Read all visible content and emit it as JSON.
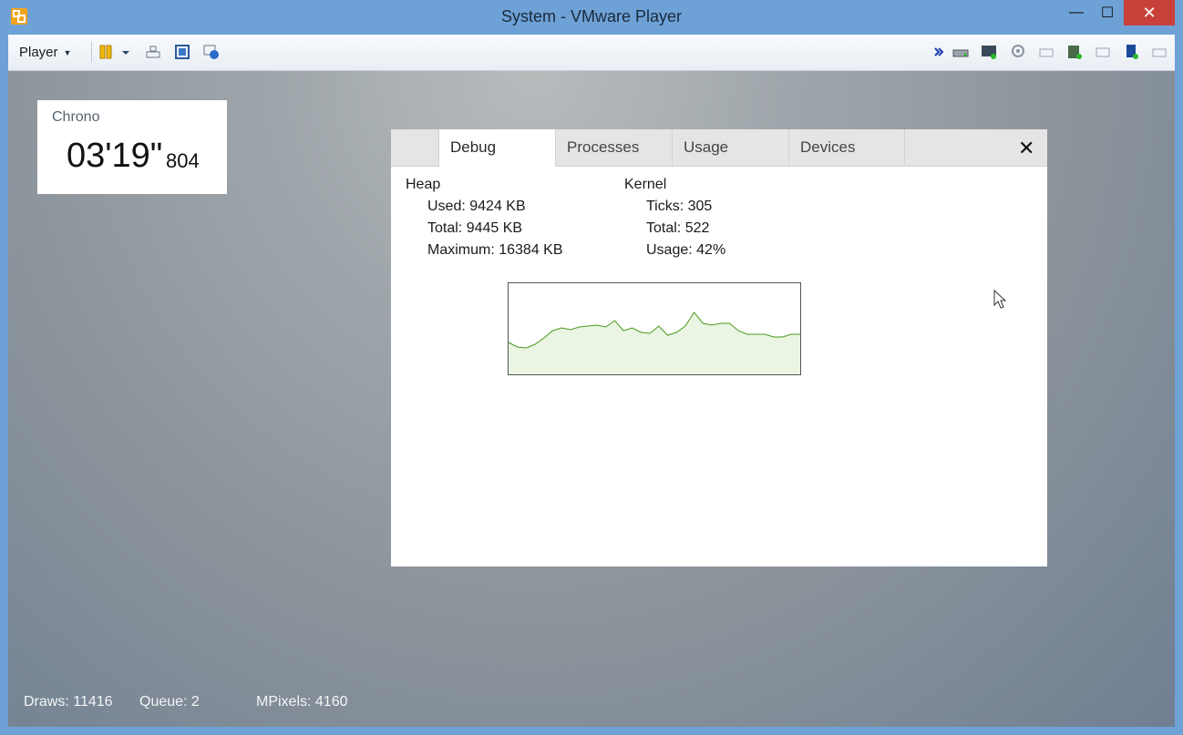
{
  "window": {
    "title": "System - VMware Player",
    "controls": {
      "minimize": "—",
      "maximize": "☐",
      "close": "✕"
    }
  },
  "toolbar": {
    "player_label": "Player"
  },
  "chrono": {
    "label": "Chrono",
    "time": "03'19\"",
    "ms": "804"
  },
  "tabs": [
    {
      "label": "Debug",
      "active": true
    },
    {
      "label": "Processes",
      "active": false
    },
    {
      "label": "Usage",
      "active": false
    },
    {
      "label": "Devices",
      "active": false
    }
  ],
  "close_tab": "✕",
  "heap": {
    "title": "Heap",
    "used": "Used: 9424 KB",
    "total": "Total: 9445 KB",
    "maximum": "Maximum: 16384 KB"
  },
  "kernel": {
    "title": "Kernel",
    "ticks": "Ticks: 305",
    "total": "Total: 522",
    "usage": "Usage: 42%"
  },
  "chart_data": {
    "type": "area",
    "ylim": [
      0,
      100
    ],
    "values": [
      35,
      30,
      29,
      33,
      40,
      48,
      51,
      49,
      52,
      53,
      54,
      52,
      59,
      48,
      51,
      46,
      45,
      53,
      43,
      46,
      53,
      68,
      56,
      54,
      56,
      56,
      48,
      44,
      44,
      44,
      41,
      41,
      44,
      44
    ],
    "line_color": "#4a9a1a",
    "fill_color": "#eaf5e3"
  },
  "status": {
    "draws": "Draws: 11416",
    "queue": "Queue: 2",
    "mpixels": "MPixels: 4160"
  }
}
